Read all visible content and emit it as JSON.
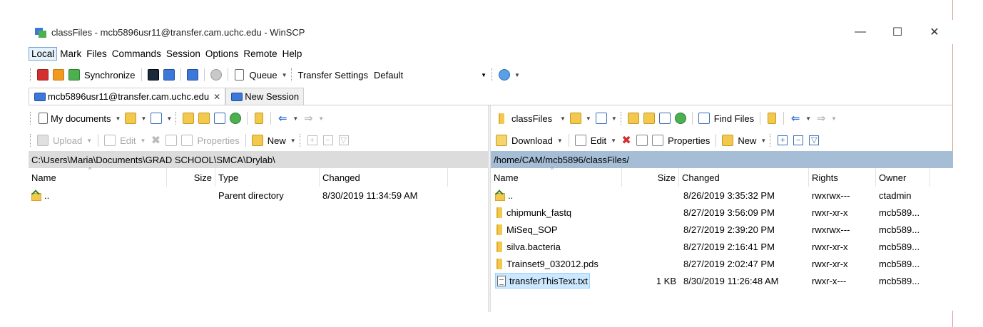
{
  "window": {
    "title": "classFiles - mcb5896usr11@transfer.cam.uchc.edu - WinSCP",
    "minimize": "—",
    "maximize": "☐",
    "close": "✕"
  },
  "menu": [
    "Local",
    "Mark",
    "Files",
    "Commands",
    "Session",
    "Options",
    "Remote",
    "Help"
  ],
  "main_toolbar": {
    "synchronize": "Synchronize",
    "queue": "Queue",
    "transfer_settings_label": "Transfer Settings",
    "transfer_settings_value": "Default"
  },
  "tabs": [
    {
      "label": "mcb5896usr11@transfer.cam.uchc.edu",
      "close": "✕"
    },
    {
      "label": "New Session"
    }
  ],
  "left": {
    "location": "My documents",
    "buttons": {
      "upload": "Upload",
      "edit": "Edit",
      "properties": "Properties",
      "new": "New"
    },
    "path": "C:\\Users\\Maria\\Documents\\GRAD SCHOOL\\SMCA\\Drylab\\",
    "columns": [
      "Name",
      "Size",
      "Type",
      "Changed"
    ],
    "rows": [
      {
        "name": "..",
        "size": "",
        "type": "Parent directory",
        "changed": "8/30/2019  11:34:59 AM"
      }
    ]
  },
  "right": {
    "location": "classFiles",
    "find_files": "Find Files",
    "buttons": {
      "download": "Download",
      "edit": "Edit",
      "properties": "Properties",
      "new": "New"
    },
    "path": "/home/CAM/mcb5896/classFiles/",
    "columns": [
      "Name",
      "Size",
      "Changed",
      "Rights",
      "Owner"
    ],
    "rows": [
      {
        "name": "..",
        "size": "",
        "changed": "8/26/2019 3:35:32 PM",
        "rights": "rwxrwx---",
        "owner": "ctadmin",
        "kind": "up"
      },
      {
        "name": "chipmunk_fastq",
        "size": "",
        "changed": "8/27/2019 3:56:09 PM",
        "rights": "rwxr-xr-x",
        "owner": "mcb589...",
        "kind": "folder"
      },
      {
        "name": "MiSeq_SOP",
        "size": "",
        "changed": "8/27/2019 2:39:20 PM",
        "rights": "rwxrwx---",
        "owner": "mcb589...",
        "kind": "folder"
      },
      {
        "name": "silva.bacteria",
        "size": "",
        "changed": "8/27/2019 2:16:41 PM",
        "rights": "rwxr-xr-x",
        "owner": "mcb589...",
        "kind": "folder"
      },
      {
        "name": "Trainset9_032012.pds",
        "size": "",
        "changed": "8/27/2019 2:02:47 PM",
        "rights": "rwxr-xr-x",
        "owner": "mcb589...",
        "kind": "folder"
      },
      {
        "name": "transferThisText.txt",
        "size": "1 KB",
        "changed": "8/30/2019 11:26:48 AM",
        "rights": "rwxr-x---",
        "owner": "mcb589...",
        "kind": "file"
      }
    ]
  }
}
